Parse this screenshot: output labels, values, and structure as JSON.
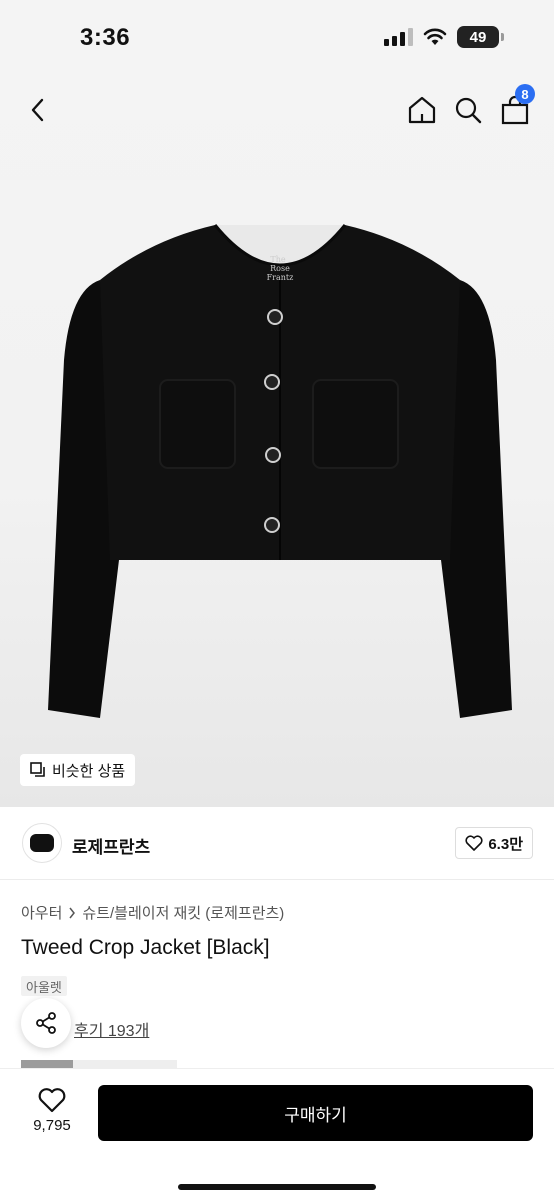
{
  "status": {
    "time": "3:36",
    "battery": "49"
  },
  "nav": {
    "cart_count": "8"
  },
  "hero": {
    "similar_label": "비슷한 상품"
  },
  "brand": {
    "name": "로제프란츠",
    "likes": "6.3만",
    "logo_text": "The Rose Frantz"
  },
  "product": {
    "breadcrumb": [
      "아우터",
      "슈트/블레이저 재킷 (로제프란츠)"
    ],
    "title": "Tweed Crop Jacket [Black]",
    "tag": "아울렛",
    "review": "후기 193개"
  },
  "bottom": {
    "wish_count": "9,795",
    "buy_label": "구매하기"
  },
  "colors": {
    "accent": "#2b6ef2",
    "button": "#000000"
  }
}
